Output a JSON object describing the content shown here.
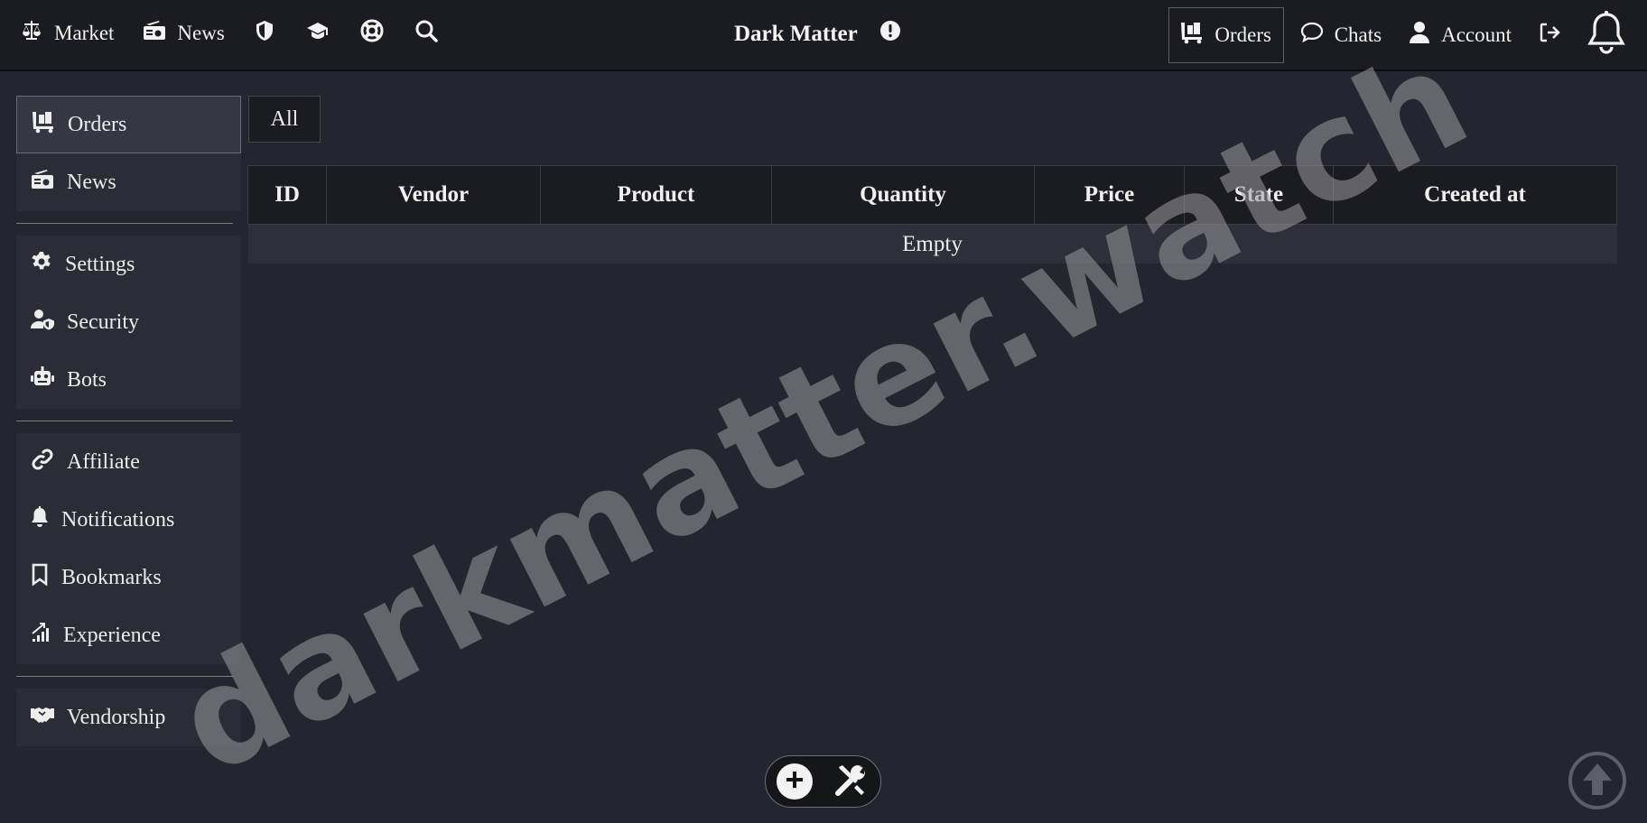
{
  "topbar": {
    "left_nav": [
      {
        "label": "Market",
        "icon": "scale-icon"
      },
      {
        "label": "News",
        "icon": "radio-icon"
      }
    ],
    "icon_nav": [
      "shield-icon",
      "graduation-cap-icon",
      "life-ring-icon",
      "search-icon"
    ],
    "brand": "Dark Matter",
    "right_nav": {
      "orders": "Orders",
      "chats": "Chats",
      "account": "Account"
    }
  },
  "sidebar": {
    "group1": [
      {
        "label": "Orders",
        "icon": "cart-icon",
        "active": true
      },
      {
        "label": "News",
        "icon": "radio-icon"
      }
    ],
    "group2": [
      {
        "label": "Settings",
        "icon": "gear-icon"
      },
      {
        "label": "Security",
        "icon": "user-shield-icon"
      },
      {
        "label": "Bots",
        "icon": "robot-icon"
      }
    ],
    "group3": [
      {
        "label": "Affiliate",
        "icon": "link-icon"
      },
      {
        "label": "Notifications",
        "icon": "bell-icon"
      },
      {
        "label": "Bookmarks",
        "icon": "bookmark-icon"
      },
      {
        "label": "Experience",
        "icon": "chart-icon"
      }
    ],
    "group4": [
      {
        "label": "Vendorship",
        "icon": "handshake-icon"
      }
    ]
  },
  "main": {
    "filter_tab": "All",
    "table": {
      "columns": [
        "ID",
        "Vendor",
        "Product",
        "Quantity",
        "Price",
        "State",
        "Created at"
      ],
      "empty_text": "Empty"
    }
  },
  "watermark": "darkmatter.watch",
  "colors": {
    "background": "#23252f",
    "topbar": "#1b1c22",
    "sidebar_group": "#2a2c36",
    "text": "#ececec"
  }
}
